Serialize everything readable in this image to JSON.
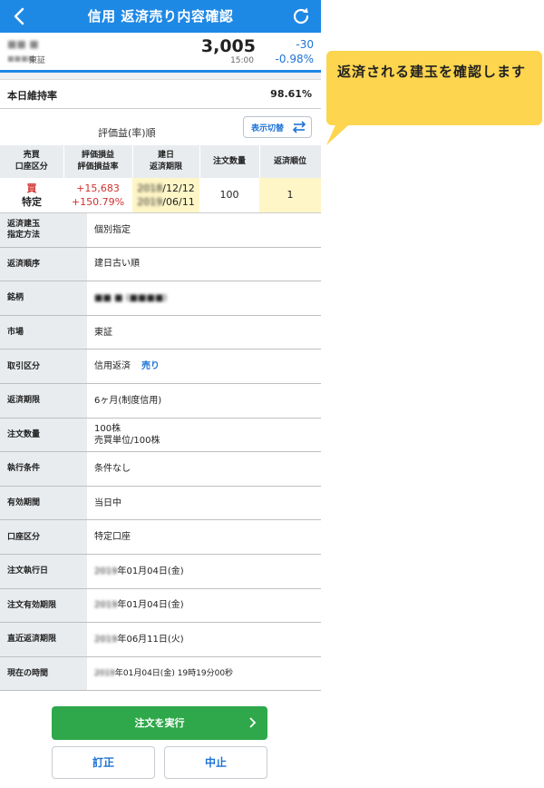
{
  "header": {
    "title": "信用 返済売り内容確認"
  },
  "stock": {
    "name": "■■ ■",
    "code": "■■■■",
    "market": "東証",
    "price": "3,005",
    "time": "15:00",
    "change": "-30",
    "change_pct": "-0.98%"
  },
  "maintenance": {
    "label": "本日維持率",
    "value": "98.61%"
  },
  "sort": {
    "label": "評価益(率)順",
    "switch_label": "表示切替"
  },
  "positions": {
    "headers": {
      "buysell": "売買",
      "account": "口座区分",
      "pl": "評価損益",
      "pl_rate": "評価損益率",
      "date": "建日",
      "due": "返済期限",
      "qty": "注文数量",
      "order": "返済順位"
    },
    "row": {
      "side": "買",
      "account": "特定",
      "pl": "+15,683",
      "pl_rate": "+150.79%",
      "date_year": "2018",
      "date_md": "/12/12",
      "due_year": "2019",
      "due_md": "/06/11",
      "qty": "100",
      "order": "1"
    }
  },
  "details": [
    {
      "label": "返済建玉\n指定方法",
      "value": "個別指定"
    },
    {
      "label": "返済順序",
      "value": "建日古い順"
    },
    {
      "label": "銘柄",
      "value": "■■ ■ (■■■■)"
    },
    {
      "label": "市場",
      "value": "東証"
    },
    {
      "label": "取引区分",
      "value": "信用返済",
      "extra": "売り"
    },
    {
      "label": "返済期限",
      "value": "6ヶ月(制度信用)"
    },
    {
      "label": "注文数量",
      "value": "100株",
      "value2": "売買単位/100株"
    },
    {
      "label": "執行条件",
      "value": "条件なし"
    },
    {
      "label": "有効期間",
      "value": "当日中"
    },
    {
      "label": "口座区分",
      "value": "特定口座"
    },
    {
      "label": "注文執行日",
      "year": "2019",
      "value": "年01月04日(金)"
    },
    {
      "label": "注文有効期限",
      "year": "2019",
      "value": "年01月04日(金)"
    },
    {
      "label": "直近返済期限",
      "year": "2019",
      "value": "年06月11日(火)"
    },
    {
      "label": "現在の時間",
      "year": "2019",
      "value": "年01月04日(金) 19時19分00秒"
    }
  ],
  "buttons": {
    "execute": "注文を実行",
    "correct": "訂正",
    "cancel": "中止"
  },
  "callout": {
    "text": "返済される建玉を確認します"
  },
  "colors": {
    "header": "#1e88e5",
    "execute": "#2ea84a",
    "callout": "#fdd54f",
    "positive": "#d32f2f",
    "negative": "#1e73d6"
  }
}
